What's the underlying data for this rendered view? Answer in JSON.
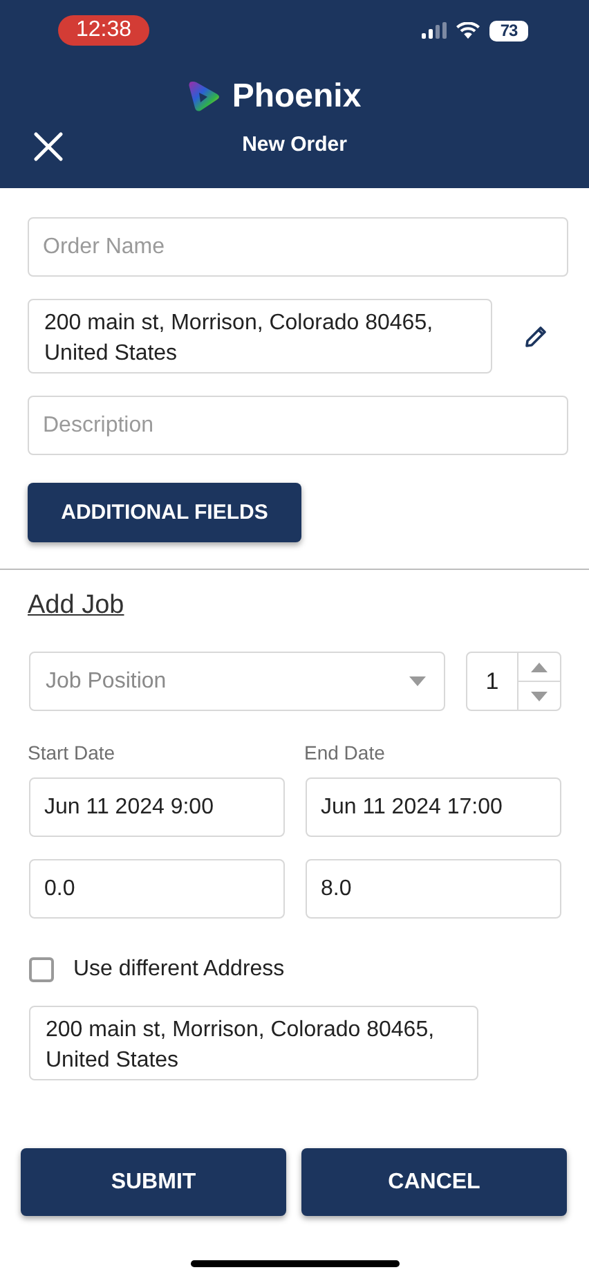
{
  "status_bar": {
    "time": "12:38",
    "battery": "73"
  },
  "header": {
    "app_name": "Phoenix",
    "title": "New Order"
  },
  "order": {
    "name": {
      "placeholder": "Order Name"
    },
    "address": {
      "value": "200 main st, Morrison, Colorado 80465, United States"
    },
    "description": {
      "placeholder": "Description"
    },
    "additional_fields_button": "ADDITIONAL FIELDS"
  },
  "job": {
    "heading": "Add Job",
    "position": {
      "placeholder": "Job Position"
    },
    "count": "1",
    "start_label": "Start Date",
    "end_label": "End Date",
    "start_date": "Jun 11 2024 9:00",
    "end_date": "Jun 11 2024 17:00",
    "start_value": "0.0",
    "end_value": "8.0",
    "different_address": {
      "label": "Use different Address",
      "checked": false
    },
    "address": {
      "value": "200 main st, Morrison, Colorado 80465, United States"
    }
  },
  "buttons": [
    "SUBMIT",
    "CANCEL"
  ]
}
